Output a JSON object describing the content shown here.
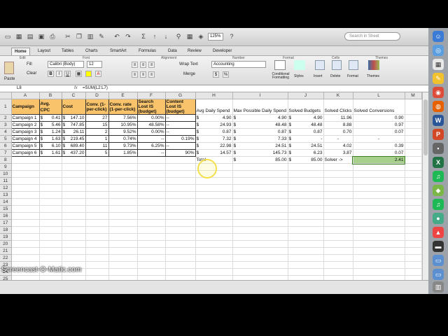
{
  "toolbar": {
    "zoom": "125%",
    "search_placeholder": "Search in Sheet"
  },
  "tabs": [
    "Home",
    "Layout",
    "Tables",
    "Charts",
    "SmartArt",
    "Formulas",
    "Data",
    "Review",
    "Developer"
  ],
  "ribbon": {
    "groups": [
      "Edit",
      "Font",
      "Alignment",
      "Number",
      "Format",
      "Cells",
      "Themes"
    ],
    "fill_label": "Fill",
    "clear_label": "Clear",
    "paste_label": "Paste",
    "font_name": "Calibri (Body)",
    "font_size": "12",
    "wrap_label": "Wrap Text",
    "merge_label": "Merge",
    "number_format": "Accounting",
    "conditional_label": "Conditional Formatting",
    "styles_label": "Styles",
    "insert_label": "Insert",
    "delete_label": "Delete",
    "format_label": "Format",
    "themes_label": "Themes"
  },
  "formula_bar": {
    "cell_ref": "L8",
    "fx": "fx",
    "formula": "=SUM(L2:L7)"
  },
  "columns": [
    "A",
    "B",
    "C",
    "D",
    "E",
    "F",
    "G",
    "H",
    "I",
    "J",
    "K",
    "L",
    "M"
  ],
  "headers": {
    "A": "Campaign",
    "B": "Avg. CPC",
    "C": "Cost",
    "D": "Conv. (1-per-click)",
    "E": "Conv. rate (1-per-click)",
    "F": "Search Lost IS (budget)",
    "G": "Content Lost IS (budget)",
    "H": "Avg Daily Spend",
    "I": "Max Possible Daily Spend",
    "J": "Solved Budgets",
    "K": "Solved Clicks",
    "L": "Solved Conversions"
  },
  "rows": [
    [
      "Campaign 1",
      "$",
      "0.41",
      "$",
      "147.10",
      "27",
      "7.56%",
      "0.00%",
      "--",
      "$",
      "4.90",
      "$",
      "4.90",
      "$",
      "4.90",
      "11.96",
      "0.90"
    ],
    [
      "Campaign 2",
      "$",
      "5.46",
      "$",
      "747.85",
      "15",
      "10.95%",
      "48.58%",
      "--",
      "$",
      "24.93",
      "$",
      "48.48",
      "$",
      "48.48",
      "8.88",
      "0.97"
    ],
    [
      "Campaign 3",
      "$",
      "1.24",
      "$",
      "26.11",
      "2",
      "9.52%",
      "0.00%",
      "--",
      "$",
      "0.87",
      "$",
      "0.87",
      "$",
      "0.87",
      "0.70",
      "0.07"
    ],
    [
      "Campaign 4",
      "$",
      "1.63",
      "$",
      "219.45",
      "1",
      "0.74%",
      "--",
      "0.19%",
      "$",
      "7.32",
      "$",
      "7.33",
      "$",
      "-",
      "-",
      "-"
    ],
    [
      "Campaign 5",
      "$",
      "6.10",
      "$",
      "689.40",
      "11",
      "9.73%",
      "6.25%",
      "--",
      "$",
      "22.98",
      "$",
      "24.51",
      "$",
      "24.51",
      "4.02",
      "0.39"
    ],
    [
      "Campaign 6",
      "$",
      "1.61",
      "$",
      "437.20",
      "5",
      "1.85%",
      "--",
      "90%",
      "$",
      "14.57",
      "$",
      "145.73",
      "$",
      "6.23",
      "3.87",
      "0.07"
    ]
  ],
  "total_row": {
    "label": "Total",
    "max_dollar": "$",
    "max_total": "85.00",
    "budget_dollar": "$",
    "budget_total": "85.00",
    "solver": "Solver ->",
    "conv_total": "2.41"
  },
  "row_numbers": [
    "1",
    "2",
    "3",
    "4",
    "5",
    "6",
    "7",
    "8",
    "9",
    "10",
    "11",
    "12",
    "13",
    "14",
    "15",
    "16",
    "17",
    "18",
    "19",
    "20",
    "21",
    "22",
    "23",
    "24",
    "25",
    "26"
  ],
  "watermark": "Screencast-O-Matic.com",
  "colors": {
    "header_fill": "#f8c36b",
    "selected_fill": "#a8d08d"
  }
}
